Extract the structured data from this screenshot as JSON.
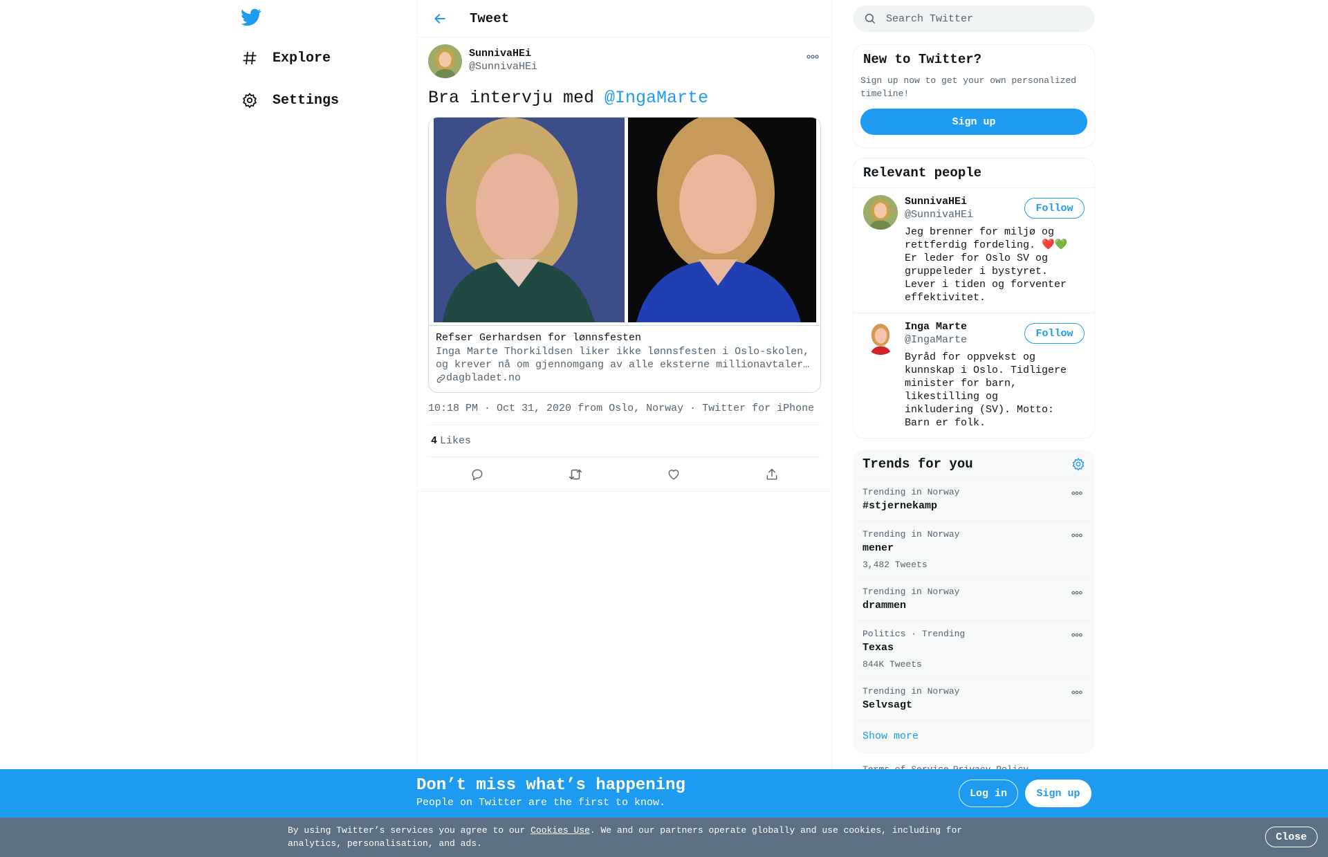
{
  "nav": {
    "logo": "twitter-bird-icon",
    "items": [
      {
        "label": "Explore",
        "icon": "hashtag-icon"
      },
      {
        "label": "Settings",
        "icon": "gear-icon"
      }
    ]
  },
  "header": {
    "title": "Tweet",
    "back_icon": "arrow-left-icon"
  },
  "tweet": {
    "author_name": "SunnivaHEi",
    "author_handle": "@SunnivaHEi",
    "text_prefix": "Bra intervju med ",
    "mention": "@IngaMarte",
    "card": {
      "title": "Refser Gerhardsen for lønnsfesten",
      "description": "Inga Marte Thorkildsen liker ikke lønnsfesten i Oslo-skolen, og krever nå om gjennomgang av alle eksterne millionavtaler…",
      "domain": "dagbladet.no"
    },
    "time": "10:18 PM · Oct 31, 2020",
    "location": "from Oslo, Norway",
    "separator": "·",
    "source": "Twitter for iPhone",
    "likes_count": "4",
    "likes_label": "Likes"
  },
  "search": {
    "placeholder": "Search Twitter"
  },
  "signup_box": {
    "title": "New to Twitter?",
    "text": "Sign up now to get your own personalized timeline!",
    "button": "Sign up"
  },
  "relevant": {
    "title": "Relevant people",
    "people": [
      {
        "name": "SunnivaHEi",
        "handle": "@SunnivaHEi",
        "bio": "Jeg brenner for miljø og rettferdig fordeling. ❤️💚 Er leder for Oslo SV og gruppeleder i bystyret. Lever i tiden og forventer effektivitet.",
        "follow": "Follow"
      },
      {
        "name": "Inga Marte",
        "handle": "@IngaMarte",
        "bio": "Byråd for oppvekst og kunnskap i Oslo. Tidligere minister for barn, likestilling og inkludering (SV). Motto: Barn er folk.",
        "follow": "Follow"
      }
    ]
  },
  "trends": {
    "title": "Trends for you",
    "items": [
      {
        "meta": "Trending in Norway",
        "name": "#stjernekamp",
        "count": ""
      },
      {
        "meta": "Trending in Norway",
        "name": "mener",
        "count": "3,482 Tweets"
      },
      {
        "meta": "Trending in Norway",
        "name": "drammen",
        "count": ""
      },
      {
        "meta": "Politics · Trending",
        "name": "Texas",
        "count": "844K Tweets"
      },
      {
        "meta": "Trending in Norway",
        "name": "Selvsagt",
        "count": ""
      }
    ],
    "show_more": "Show more"
  },
  "footer": {
    "terms": "Terms of Service",
    "privacy": "Privacy Policy"
  },
  "banner": {
    "title": "Don’t miss what’s happening",
    "subtitle": "People on Twitter are the first to know.",
    "login": "Log in",
    "signup": "Sign up"
  },
  "cookie": {
    "text_before": "By using Twitter’s services you agree to our ",
    "link": "Cookies Use",
    "text_after": ". We and our partners operate globally and use cookies, including for analytics, personalisation, and ads.",
    "close": "Close"
  },
  "colors": {
    "brand": "#1d9bf0",
    "cookie_bar": "#5b7083"
  }
}
